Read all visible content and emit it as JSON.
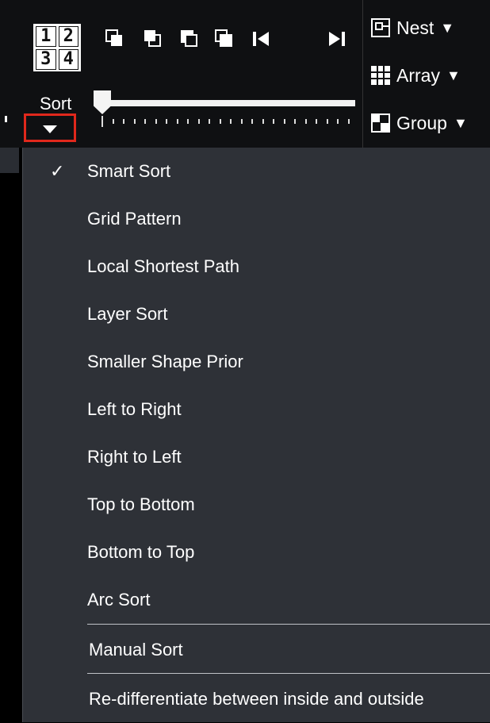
{
  "toolbar": {
    "order_grid": [
      "1",
      "2",
      "3",
      "4"
    ],
    "sort_label": "Sort",
    "nest_label": "Nest",
    "array_label": "Array",
    "group_label": "Group"
  },
  "icons": {
    "order_grid": "number-order-grid-icon",
    "move_back": "move-back-icon",
    "move_forward": "move-forward-icon",
    "send_to_back": "send-to-back-icon",
    "bring_to_front": "bring-to-front-icon",
    "first": "skip-first-icon",
    "last": "skip-last-icon",
    "nest": "nest-icon",
    "array": "array-grid-icon",
    "group": "group-icon",
    "dropdown": "triangle-down-icon",
    "check": "checkmark-icon"
  },
  "sort_menu": {
    "selected_index": 0,
    "items": [
      {
        "label": "Smart Sort",
        "checked": "✓"
      },
      {
        "label": "Grid Pattern"
      },
      {
        "label": "Local Shortest Path"
      },
      {
        "label": "Layer Sort"
      },
      {
        "label": "Smaller Shape Prior"
      },
      {
        "label": "Left to Right"
      },
      {
        "label": "Right to Left"
      },
      {
        "label": "Top to Bottom"
      },
      {
        "label": "Bottom to Top"
      },
      {
        "label": "Arc Sort"
      },
      {
        "label": "Manual Sort"
      },
      {
        "label": "Re-differentiate between inside and outside"
      }
    ]
  },
  "colors": {
    "toolbar_bg": "#0f1012",
    "menu_bg": "#2e3137",
    "highlight": "#e0281c",
    "text": "#ffffff"
  }
}
